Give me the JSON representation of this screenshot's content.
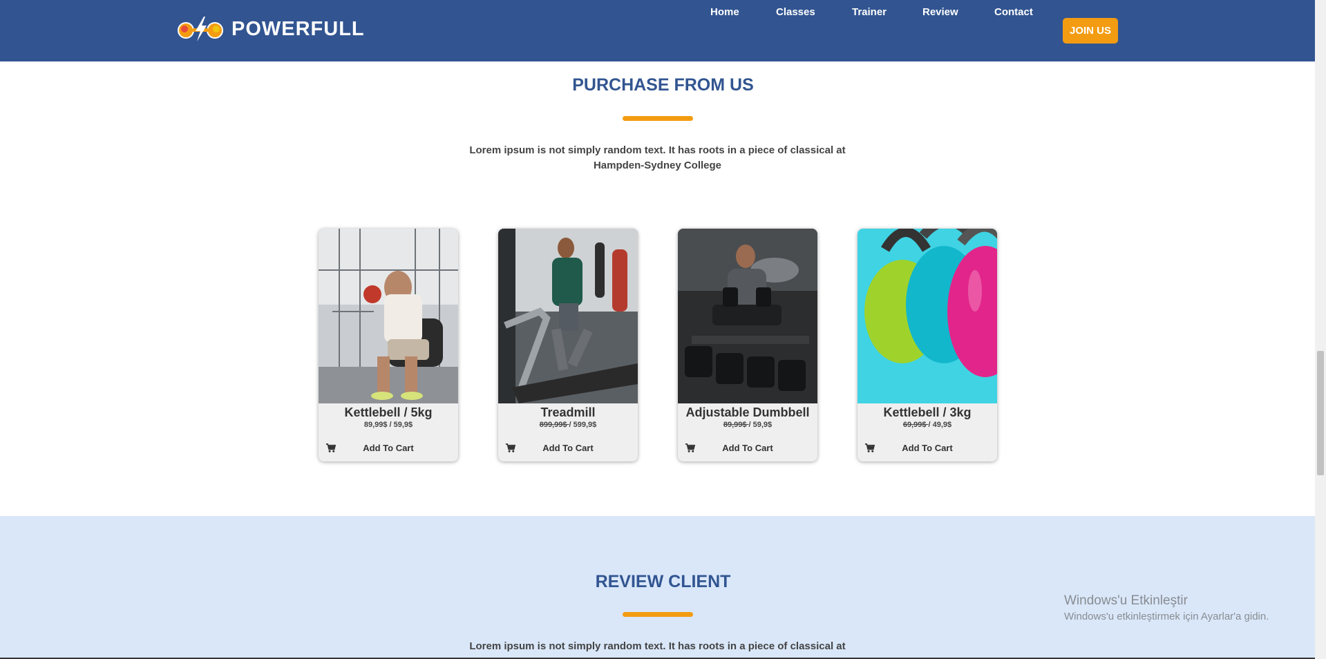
{
  "header": {
    "brand": "POWERFULL",
    "logo_icon": "dumbbell-lightning-logo",
    "nav": [
      {
        "label": "Home"
      },
      {
        "label": "Classes"
      },
      {
        "label": "Trainer"
      },
      {
        "label": "Review"
      },
      {
        "label": "Contact"
      }
    ],
    "join_label": "JOIN US"
  },
  "purchase": {
    "title": "PURCHASE FROM US",
    "intro": "Lorem ipsum is not simply random text. It has roots in a piece of classical at Hampden-Sydney College",
    "products": [
      {
        "name": "Kettlebell / 5kg",
        "old_price": "89,99$ / 59,9$",
        "new_price": "",
        "cart_label": "Add To Cart",
        "image": "man-with-red-kettlebell-photo"
      },
      {
        "name": "Treadmill",
        "old_price": "899,99$ ",
        "new_price": "/ 599,9$",
        "cart_label": "Add To Cart",
        "image": "man-on-treadmill-photo"
      },
      {
        "name": "Adjustable Dumbbell",
        "old_price": "89,99$ ",
        "new_price": "/ 59,9$",
        "cart_label": "Add To Cart",
        "image": "man-with-dumbbells-photo"
      },
      {
        "name": "Kettlebell / 3kg",
        "old_price": "69,99$ ",
        "new_price": "/ 49,9$",
        "cart_label": "Add To Cart",
        "image": "colorful-kettlebells-photo"
      }
    ]
  },
  "review": {
    "title": "REVIEW CLIENT",
    "intro": "Lorem ipsum is not simply random text. It has roots in a piece of classical at"
  },
  "watermark": {
    "title": "Windows'u Etkinleştir",
    "subtitle": "Windows'u etkinleştirmek için Ayarlar'a gidin."
  },
  "colors": {
    "header": "#325591",
    "accent": "#f39c12",
    "review_bg": "#d9e7f9"
  }
}
